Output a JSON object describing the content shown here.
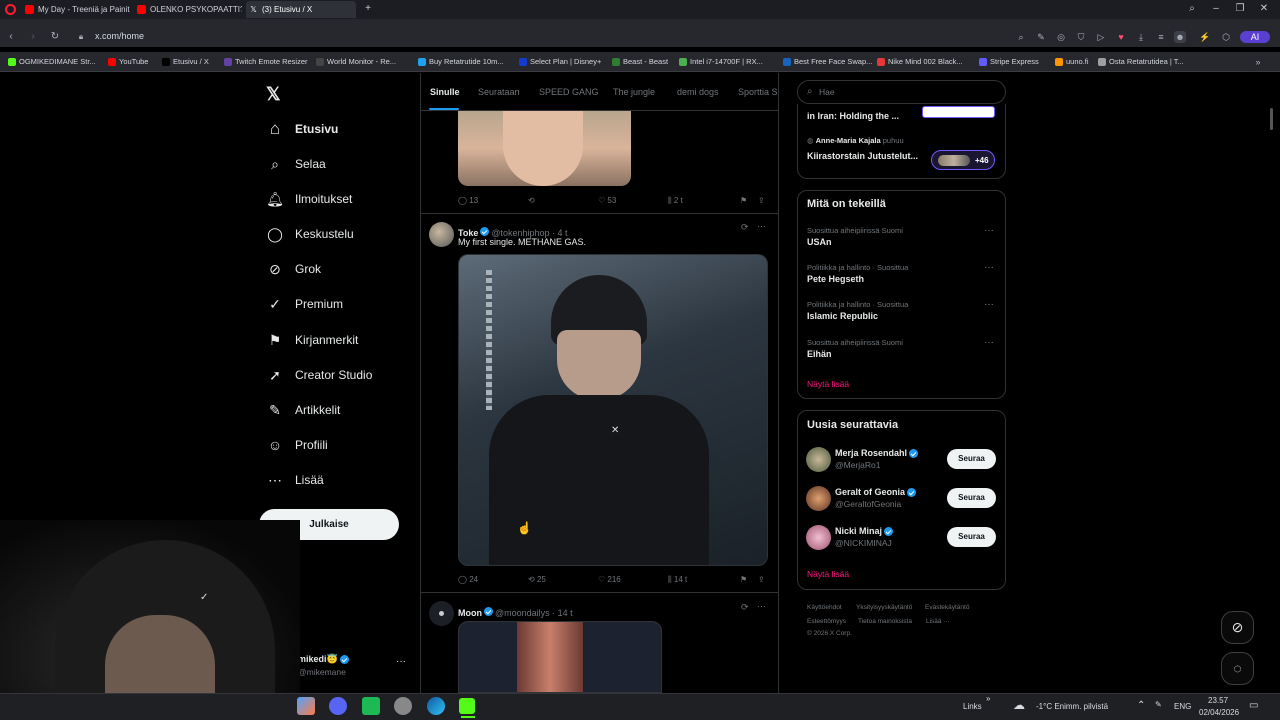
{
  "browser": {
    "tabs": [
      {
        "title": "My Day - Treeniä ja Painit",
        "color": "#ff0000"
      },
      {
        "title": "OLENKO PSYKOPAATTI? Fi",
        "color": "#ff0000"
      },
      {
        "title": "(3) Etusivu / X",
        "color": "#000000"
      }
    ],
    "new_tab": "+",
    "url": "x.com/home",
    "ai_label": "AI",
    "bookmarks": [
      {
        "label": "OGMIKEDIMANE Str...",
        "color": "#53fc18"
      },
      {
        "label": "YouTube",
        "color": "#ff0000"
      },
      {
        "label": "Etusivu / X",
        "color": "#000000"
      },
      {
        "label": "Twitch Emote Resizer",
        "color": "#6441a5"
      },
      {
        "label": "World Monitor - Re...",
        "color": "#444444"
      },
      {
        "label": "Buy Retatrutide 10m...",
        "color": "#1da1f2"
      },
      {
        "label": "Select Plan | Disney+",
        "color": "#113ccf"
      },
      {
        "label": "Beast - Beast",
        "color": "#2e7d32"
      },
      {
        "label": "Intel i7-14700F | RX...",
        "color": "#4caf50"
      },
      {
        "label": "Best Free Face Swap...",
        "color": "#1565c0"
      },
      {
        "label": "Nike Mind 002 Black...",
        "color": "#e53935"
      },
      {
        "label": "Stripe Express",
        "color": "#635bff"
      },
      {
        "label": "uuno.fi",
        "color": "#ff9800"
      },
      {
        "label": "Osta Retatrutidea | T...",
        "color": "#9e9e9e"
      }
    ]
  },
  "nav": {
    "items": [
      {
        "label": "Etusivu",
        "icon": "home-icon"
      },
      {
        "label": "Selaa",
        "icon": "search-icon"
      },
      {
        "label": "Ilmoitukset",
        "icon": "bell-icon"
      },
      {
        "label": "Keskustelu",
        "icon": "chat-icon"
      },
      {
        "label": "Grok",
        "icon": "grok-icon"
      },
      {
        "label": "Premium",
        "icon": "premium-icon"
      },
      {
        "label": "Kirjanmerkit",
        "icon": "bookmark-icon"
      },
      {
        "label": "Creator Studio",
        "icon": "rocket-icon"
      },
      {
        "label": "Artikkelit",
        "icon": "article-icon"
      },
      {
        "label": "Profiili",
        "icon": "person-icon"
      },
      {
        "label": "Lisää",
        "icon": "more-circle-icon"
      }
    ],
    "post_button": "Julkaise",
    "account": {
      "name": "mikedi",
      "emoji": "😇",
      "handle": "@mikemane"
    }
  },
  "feed": {
    "tabs": [
      "Sinulle",
      "Seurataan",
      "SPEED GANG",
      "The jungle",
      "demi dogs",
      "Sporttia S"
    ],
    "tweet1": {
      "replies": "13",
      "likes": "53",
      "views": "2 t"
    },
    "tweet2": {
      "name": "Toke",
      "handle": "@tokenhiphop",
      "time": "4 t",
      "text": "My first single. METHANE GAS.",
      "replies": "24",
      "retweets": "25",
      "likes": "216",
      "views": "14 t"
    },
    "tweet3": {
      "name": "Moon",
      "handle": "@moondailys",
      "time": "14 t"
    }
  },
  "sidebar": {
    "search_placeholder": "Hae",
    "spaces": [
      {
        "title": "in Iran: Holding the ..."
      },
      {
        "host": "Anne-Maria Kajala",
        "host_suffix": "puhuu",
        "title": "Kiirastorstain Jutustelut...",
        "count": "+46"
      }
    ],
    "trending": {
      "heading": "Mitä on tekeillä",
      "items": [
        {
          "meta": "Suosittua aiheipiirissä Suomi",
          "title": "USAn"
        },
        {
          "meta": "Politiikka ja hallinto · Suosittua",
          "title": "Pete Hegseth"
        },
        {
          "meta": "Politiikka ja hallinto · Suosittua",
          "title": "Islamic Republic"
        },
        {
          "meta": "Suosittua aiheipiirissä Suomi",
          "title": "Eihän"
        }
      ],
      "show_more": "Näytä lisää"
    },
    "who_to_follow": {
      "heading": "Uusia seurattavia",
      "items": [
        {
          "name": "Merja Rosendahl",
          "handle": "@MerjaRo1",
          "button": "Seuraa"
        },
        {
          "name": "Geralt of Geonia",
          "handle": "@GeraltofGeonia",
          "button": "Seuraa"
        },
        {
          "name": "Nicki Minaj",
          "handle": "@NICKIMINAJ",
          "button": "Seuraa"
        }
      ],
      "show_more": "Näytä lisää"
    },
    "footer": {
      "row1": [
        "Käyttöehdot",
        "Yksityisyyskäytäntö",
        "Evästekäytäntö"
      ],
      "row2": [
        "Esteettömyys",
        "Tietoa mainoksista",
        "Lisää ···"
      ],
      "copyright": "© 2026 X Corp."
    }
  },
  "taskbar": {
    "links": "Links",
    "weather": "-1°C  Enimm. pilvistä",
    "lang": "ENG",
    "time": "23.57",
    "date": "02/04/2026"
  }
}
